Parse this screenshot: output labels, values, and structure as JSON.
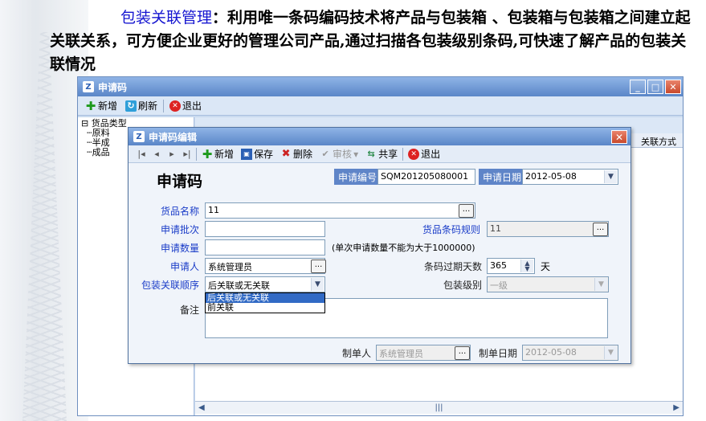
{
  "intro": {
    "highlight": "包装关联管理",
    "text": "：利用唯一条码编码技术将产品与包装箱 、包装箱与包装箱之间建立起关联关系，可方便企业更好的管理公司产品,通过扫描各包装级别条码,可快速了解产品的包装关联情况"
  },
  "main_window": {
    "title": "申请码",
    "toolbar": {
      "add": "新增",
      "refresh": "刷新",
      "exit": "退出"
    },
    "tree": {
      "root": "货品类型",
      "children": [
        "原料",
        "半成",
        "成品"
      ]
    },
    "grid": {
      "visible_header": "关联方式"
    }
  },
  "dialog": {
    "title": "申请码编辑",
    "toolbar": {
      "nav_first": "|◂",
      "nav_prev": "◂",
      "nav_next": "▸",
      "nav_last": "▸|",
      "add": "新增",
      "save": "保存",
      "delete": "删除",
      "review": "审核",
      "share": "共享",
      "exit": "退出"
    },
    "heading": "申请码",
    "apply_no_label": "申请编号",
    "apply_no": "SQM201205080001",
    "apply_date_label": "申请日期",
    "apply_date": "2012-05-08",
    "product_name_label": "货品名称",
    "product_name": "11",
    "batch_label": "申请批次",
    "batch": "",
    "barcode_rule_label": "货品条码规则",
    "barcode_rule": "11",
    "qty_label": "申请数量",
    "qty": "",
    "qty_hint": "(单次申请数量不能为大于1000000)",
    "applicant_label": "申请人",
    "applicant": "系统管理员",
    "expire_label": "条码过期天数",
    "expire_days": "365",
    "expire_unit": "天",
    "pack_order_label": "包装关联顺序",
    "pack_order": "后关联或无关联",
    "pack_order_options": [
      "后关联或无关联",
      "前关联"
    ],
    "pack_level_label": "包装级别",
    "pack_level": "一级",
    "remark_label": "备注",
    "remark": "",
    "creator_label": "制单人",
    "creator": "系统管理员",
    "create_date_label": "制单日期",
    "create_date": "2012-05-08"
  }
}
